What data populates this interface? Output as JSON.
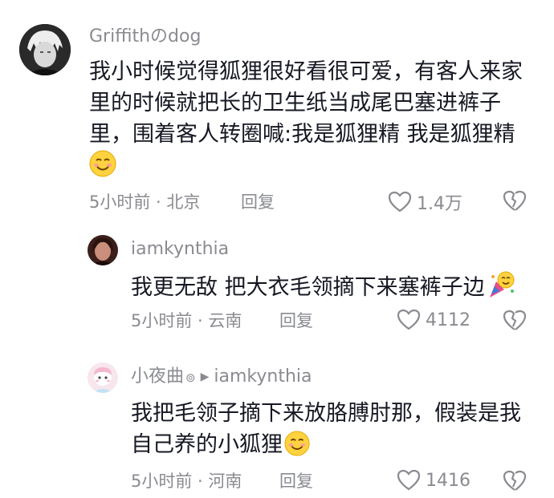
{
  "comments": [
    {
      "user": "Griffithのdog",
      "lines": [
        "我小时候觉得狐狸很好看很可爱，有客人来家",
        "里的时候就把长的卫生纸当成尾巴塞进裤子",
        "里，围着客人转圈喊:我是狐狸精 我是狐狸精"
      ],
      "time_loc": "5小时前 · 北京",
      "reply_label": "回复",
      "likes": "1.4万"
    },
    {
      "user": "iamkynthia",
      "lines": [
        "我更无敌 把大衣毛领摘下来塞裤子边"
      ],
      "time_loc": "5小时前 · 云南",
      "reply_label": "回复",
      "likes": "4112"
    },
    {
      "user": "小夜曲",
      "reply_to": "iamkynthia",
      "lines": [
        "我把毛领子摘下来放胳膊肘那，假装是我",
        "自己养的小狐狸"
      ],
      "time_loc": "5小时前 · 河南",
      "reply_label": "回复",
      "likes": "1416"
    }
  ],
  "icons": [
    "heart-icon",
    "broken-heart-icon",
    "smile-emoji",
    "party-emoji"
  ]
}
